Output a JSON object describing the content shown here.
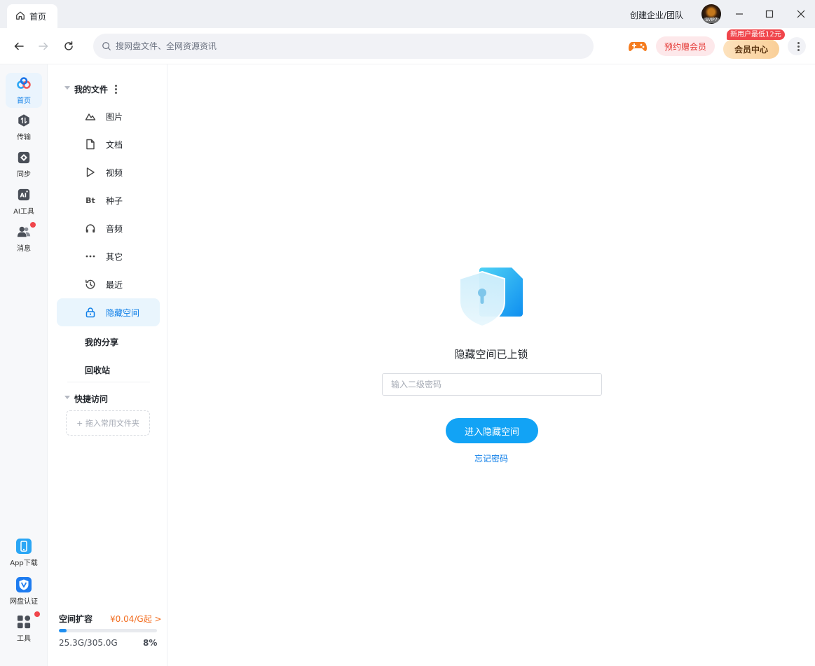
{
  "titlebar": {
    "tab_label": "首页",
    "create_team": "创建企业/团队",
    "avatar_badge": "SVIP7"
  },
  "navbar": {
    "search_placeholder": "搜网盘文件、全网资源资讯",
    "reserve_label": "预约赠会员",
    "vip_badge": "新用户最低12元",
    "vip_center": "会员中心"
  },
  "rail": {
    "items": [
      {
        "label": "首页",
        "icon": "baidu-cloud-logo-icon"
      },
      {
        "label": "传输",
        "icon": "transfer-icon"
      },
      {
        "label": "同步",
        "icon": "sync-icon"
      },
      {
        "label": "AI工具",
        "icon": "ai-icon"
      },
      {
        "label": "消息",
        "icon": "message-icon"
      }
    ],
    "bottom": [
      {
        "label": "App下载",
        "icon": "phone-icon"
      },
      {
        "label": "网盘认证",
        "icon": "verify-icon"
      },
      {
        "label": "工具",
        "icon": "grid-icon"
      }
    ]
  },
  "sidebar": {
    "my_files": "我的文件",
    "items": [
      {
        "label": "图片",
        "icon": "image-icon"
      },
      {
        "label": "文档",
        "icon": "document-icon"
      },
      {
        "label": "视频",
        "icon": "video-icon"
      },
      {
        "label": "种子",
        "icon": "bt-icon",
        "glyph": "Bt"
      },
      {
        "label": "音频",
        "icon": "headphones-icon"
      },
      {
        "label": "其它",
        "icon": "more-icon"
      },
      {
        "label": "最近",
        "icon": "history-icon"
      },
      {
        "label": "隐藏空间",
        "icon": "lock-icon"
      }
    ],
    "my_share": "我的分享",
    "recycle": "回收站",
    "quick_access": "快捷访问",
    "drop_folder": "+ 拖入常用文件夹",
    "expand_title": "空间扩容",
    "expand_price": "¥0.04/G起 >",
    "storage_used": "25.3G/305.0G",
    "storage_percent": "8%",
    "storage_fraction": 0.08
  },
  "main": {
    "lock_title": "隐藏空间已上锁",
    "password_placeholder": "输入二级密码",
    "enter_button": "进入隐藏空间",
    "forgot": "忘记密码"
  },
  "colors": {
    "accent": "#12a3f5",
    "link": "#0d7ee8",
    "alert": "#f0454b"
  }
}
